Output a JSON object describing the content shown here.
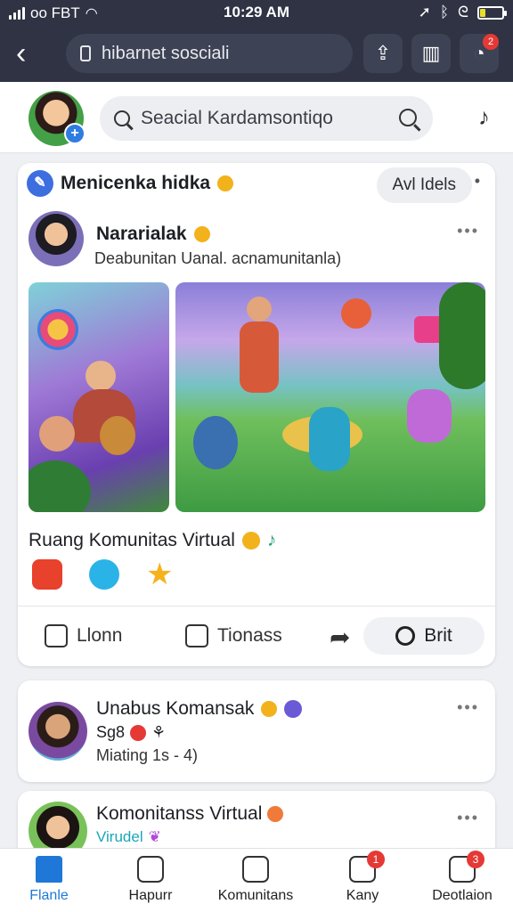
{
  "status_bar": {
    "carrier": "oo FBT",
    "time": "10:29 AM",
    "icons": [
      "signal-icon",
      "wifi-icon",
      "location-icon",
      "bluetooth-icon",
      "battery-icon"
    ],
    "battery_level": 0.25
  },
  "browser": {
    "url": "hibarnet sosciali",
    "icons": [
      "back-icon",
      "lock-icon",
      "share-icon",
      "stats-icon",
      "notification-icon"
    ],
    "notification_badge": "2"
  },
  "header": {
    "search_placeholder": "Seacial Kardamsontiqo",
    "icons": [
      "avatar",
      "plus-icon",
      "search-icon",
      "music-icon"
    ]
  },
  "feed": {
    "card1": {
      "group_label": "Menicenka hidka",
      "add_button": "Avl Idels",
      "author": "Nararialak",
      "subtitle": "Deabunitan Uanal. acnamunitanla)",
      "title": "Ruang Komunitas Virtual",
      "actions": {
        "like": "Llonn",
        "comment": "Tionass",
        "print": "Brit"
      }
    },
    "card2": {
      "name": "Unabus Komansak",
      "count": "Sg8",
      "meta": "Miating 1s - 4)"
    },
    "card3": {
      "name": "Komonitanss Virtual",
      "sub": "Virudel"
    }
  },
  "bottom_nav": {
    "tabs": [
      {
        "label": "Flanle",
        "icon": "home-icon",
        "active": true
      },
      {
        "label": "Hapurr",
        "icon": "report-icon"
      },
      {
        "label": "Komunitans",
        "icon": "community-icon"
      },
      {
        "label": "Kany",
        "icon": "inbox-icon",
        "badge": "1"
      },
      {
        "label": "Deotlaion",
        "icon": "profile-icon",
        "badge": "3"
      }
    ]
  },
  "colors": {
    "accent": "#1f78d8",
    "topbar": "#2f3344",
    "badge": "#e53935"
  }
}
